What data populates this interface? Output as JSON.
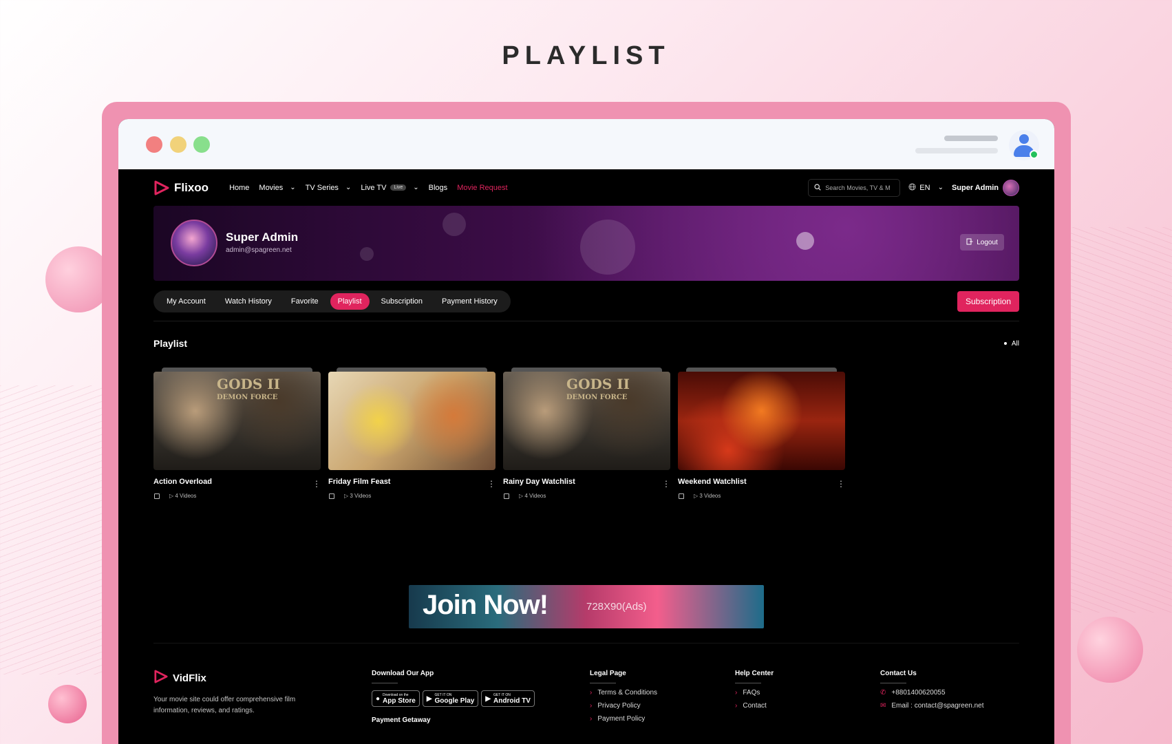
{
  "page_heading": "PLAYLIST",
  "brand": {
    "name": "Flixoo",
    "accent": "#e0245e"
  },
  "nav": {
    "items": [
      {
        "label": "Home",
        "dropdown": false
      },
      {
        "label": "Movies",
        "dropdown": true
      },
      {
        "label": "TV Series",
        "dropdown": true
      },
      {
        "label": "Live TV",
        "dropdown": true,
        "badge": "Live"
      },
      {
        "label": "Blogs",
        "dropdown": false
      },
      {
        "label": "Movie Request",
        "dropdown": false,
        "active": true
      }
    ],
    "search_placeholder": "Search Movies, TV & M",
    "language": "EN",
    "user_name": "Super Admin"
  },
  "profile": {
    "name": "Super Admin",
    "email": "admin@spagreen.net",
    "logout_label": "Logout"
  },
  "tabs": [
    {
      "label": "My Account"
    },
    {
      "label": "Watch History"
    },
    {
      "label": "Favorite"
    },
    {
      "label": "Playlist",
      "active": true
    },
    {
      "label": "Subscription"
    },
    {
      "label": "Payment History"
    }
  ],
  "subscription_button": "Subscription",
  "playlist": {
    "title": "Playlist",
    "filter": "All",
    "items": [
      {
        "title": "Action Overload",
        "videos": "4 Videos",
        "thumb": "gods"
      },
      {
        "title": "Friday Film Feast",
        "videos": "3 Videos",
        "thumb": "friday"
      },
      {
        "title": "Rainy Day Watchlist",
        "videos": "4 Videos",
        "thumb": "gods"
      },
      {
        "title": "Weekend Watchlist",
        "videos": "3 Videos",
        "thumb": "fire"
      }
    ],
    "thumb_text": {
      "line1": "GODS II",
      "line2": "DEMON FORCE"
    }
  },
  "ad": {
    "headline": "Join Now!",
    "size": "728X90(Ads)"
  },
  "footer": {
    "brand": "VidFlix",
    "description": "Your movie site could offer comprehensive film information, reviews, and ratings.",
    "download_heading": "Download Our App",
    "badges": [
      {
        "small": "Download on the",
        "label": "App Store"
      },
      {
        "small": "GET IT ON",
        "label": "Google Play"
      },
      {
        "small": "GET IT ON",
        "label": "Android TV"
      }
    ],
    "payment_heading": "Payment Getaway",
    "legal": {
      "heading": "Legal Page",
      "links": [
        "Terms & Conditions",
        "Privacy Policy",
        "Payment Policy"
      ]
    },
    "help": {
      "heading": "Help Center",
      "links": [
        "FAQs",
        "Contact"
      ]
    },
    "contact": {
      "heading": "Contact Us",
      "phone": "+8801400620055",
      "email": "Email : contact@spagreen.net"
    }
  }
}
